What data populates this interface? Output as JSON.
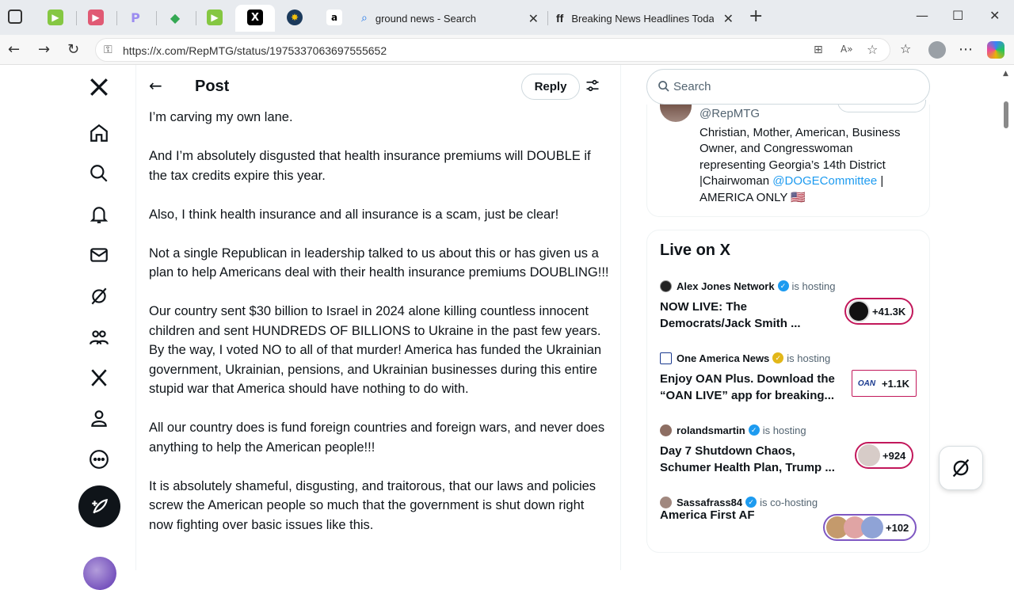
{
  "browser": {
    "tabs": [
      {
        "icon": "tab-icon-grid"
      },
      {
        "icon": "tab-icon-rumble"
      },
      {
        "icon": "tab-icon-youtube"
      },
      {
        "icon": "tab-icon-p"
      },
      {
        "icon": "tab-icon-maps"
      },
      {
        "icon": "tab-icon-rumble-2"
      },
      {
        "icon": "tab-icon-x",
        "active": true
      },
      {
        "icon": "tab-icon-news"
      },
      {
        "icon": "tab-icon-amazon"
      },
      {
        "title": "ground news - Search"
      },
      {
        "title": "Breaking News Headlines Today |"
      }
    ],
    "new_tab": "+",
    "url": "https://x.com/RepMTG/status/1975337063697555652"
  },
  "header": {
    "title": "Post",
    "reply_label": "Reply"
  },
  "post": {
    "paragraphs": [
      "I’m carving my own lane.",
      "And I’m absolutely disgusted that health insurance premiums will DOUBLE if the tax credits expire this year.",
      "Also, I think health insurance and all insurance is a scam, just be clear!",
      "Not a single Republican in leadership talked to us about this or has given us a plan to help Americans deal with their health insurance premiums DOUBLING!!!",
      "Our country sent $30 billion to Israel in 2024 alone killing countless innocent children and sent HUNDREDS OF BILLIONS to Ukraine in the past few years.  By the way, I voted NO to all of that murder! America has funded the Ukrainian government, Ukrainian, pensions, and Ukrainian businesses during this entire stupid war that America should have nothing to do with.",
      "All our country does is fund foreign countries and foreign wars, and never does anything to help the American people!!!",
      "It is absolutely shameful, disgusting, and traitorous, that our laws and policies screw the American people so much that the government is shut down right now fighting over basic issues like this."
    ]
  },
  "search": {
    "placeholder": "Search"
  },
  "profile": {
    "handle": "@RepMTG",
    "bio_text": "Christian, Mother, American, Business Owner, and Congresswoman representing Georgia’s 14th District |Chairwoman ",
    "bio_link": "@DOGECommittee",
    "bio_tail": " | AMERICA ONLY 🇺🇸"
  },
  "live": {
    "title": "Live on X",
    "items": [
      {
        "host": "Alex Jones Network",
        "status": "is hosting",
        "badge_color": "#1d9bf0",
        "text": "NOW LIVE: The Democrats/Jack Smith ...",
        "count": "+41.3K"
      },
      {
        "host": "One America News",
        "status": "is hosting",
        "badge_color": "#e2b719",
        "text": "Enjoy OAN Plus. Download the “OAN LIVE” app for breaking...",
        "count": "+1.1K"
      },
      {
        "host": "rolandsmartin",
        "status": "is hosting",
        "badge_color": "#1d9bf0",
        "text": "Day 7 Shutdown Chaos, Schumer Health Plan, Trump ...",
        "count": "+924"
      },
      {
        "host": "Sassafrass84",
        "status": "is co-hosting",
        "badge_color": "#1d9bf0",
        "text": "America First AF",
        "count": "+102"
      }
    ]
  },
  "colors": {
    "accent": "#1d9bf0",
    "live_border": "#c2185b",
    "text": "#0f1419",
    "muted": "#536471"
  }
}
